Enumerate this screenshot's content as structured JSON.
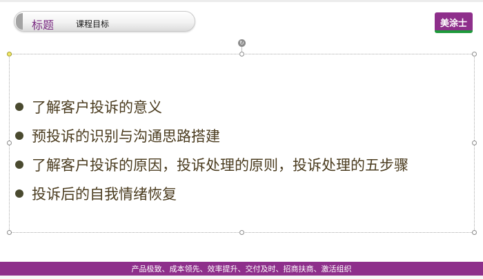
{
  "header": {
    "title_label": "标题",
    "title_text": "课程目标"
  },
  "logo": {
    "text": "美涂士",
    "brand_color": "#8e2f8b",
    "accent_color": "#1d9a3a"
  },
  "content": {
    "bullets": [
      "了解客户投诉的意义",
      "预投诉的识别与沟通思路搭建",
      "了解客户投诉的原因，投诉处理的原则，投诉处理的五步骤",
      "投诉后的自我情绪恢复"
    ]
  },
  "footer": {
    "text": "产品极致、成本领先、效率提升、交付及时、招商扶商、激活组织"
  },
  "selection": {
    "rotate_icon": "rotate-icon"
  }
}
